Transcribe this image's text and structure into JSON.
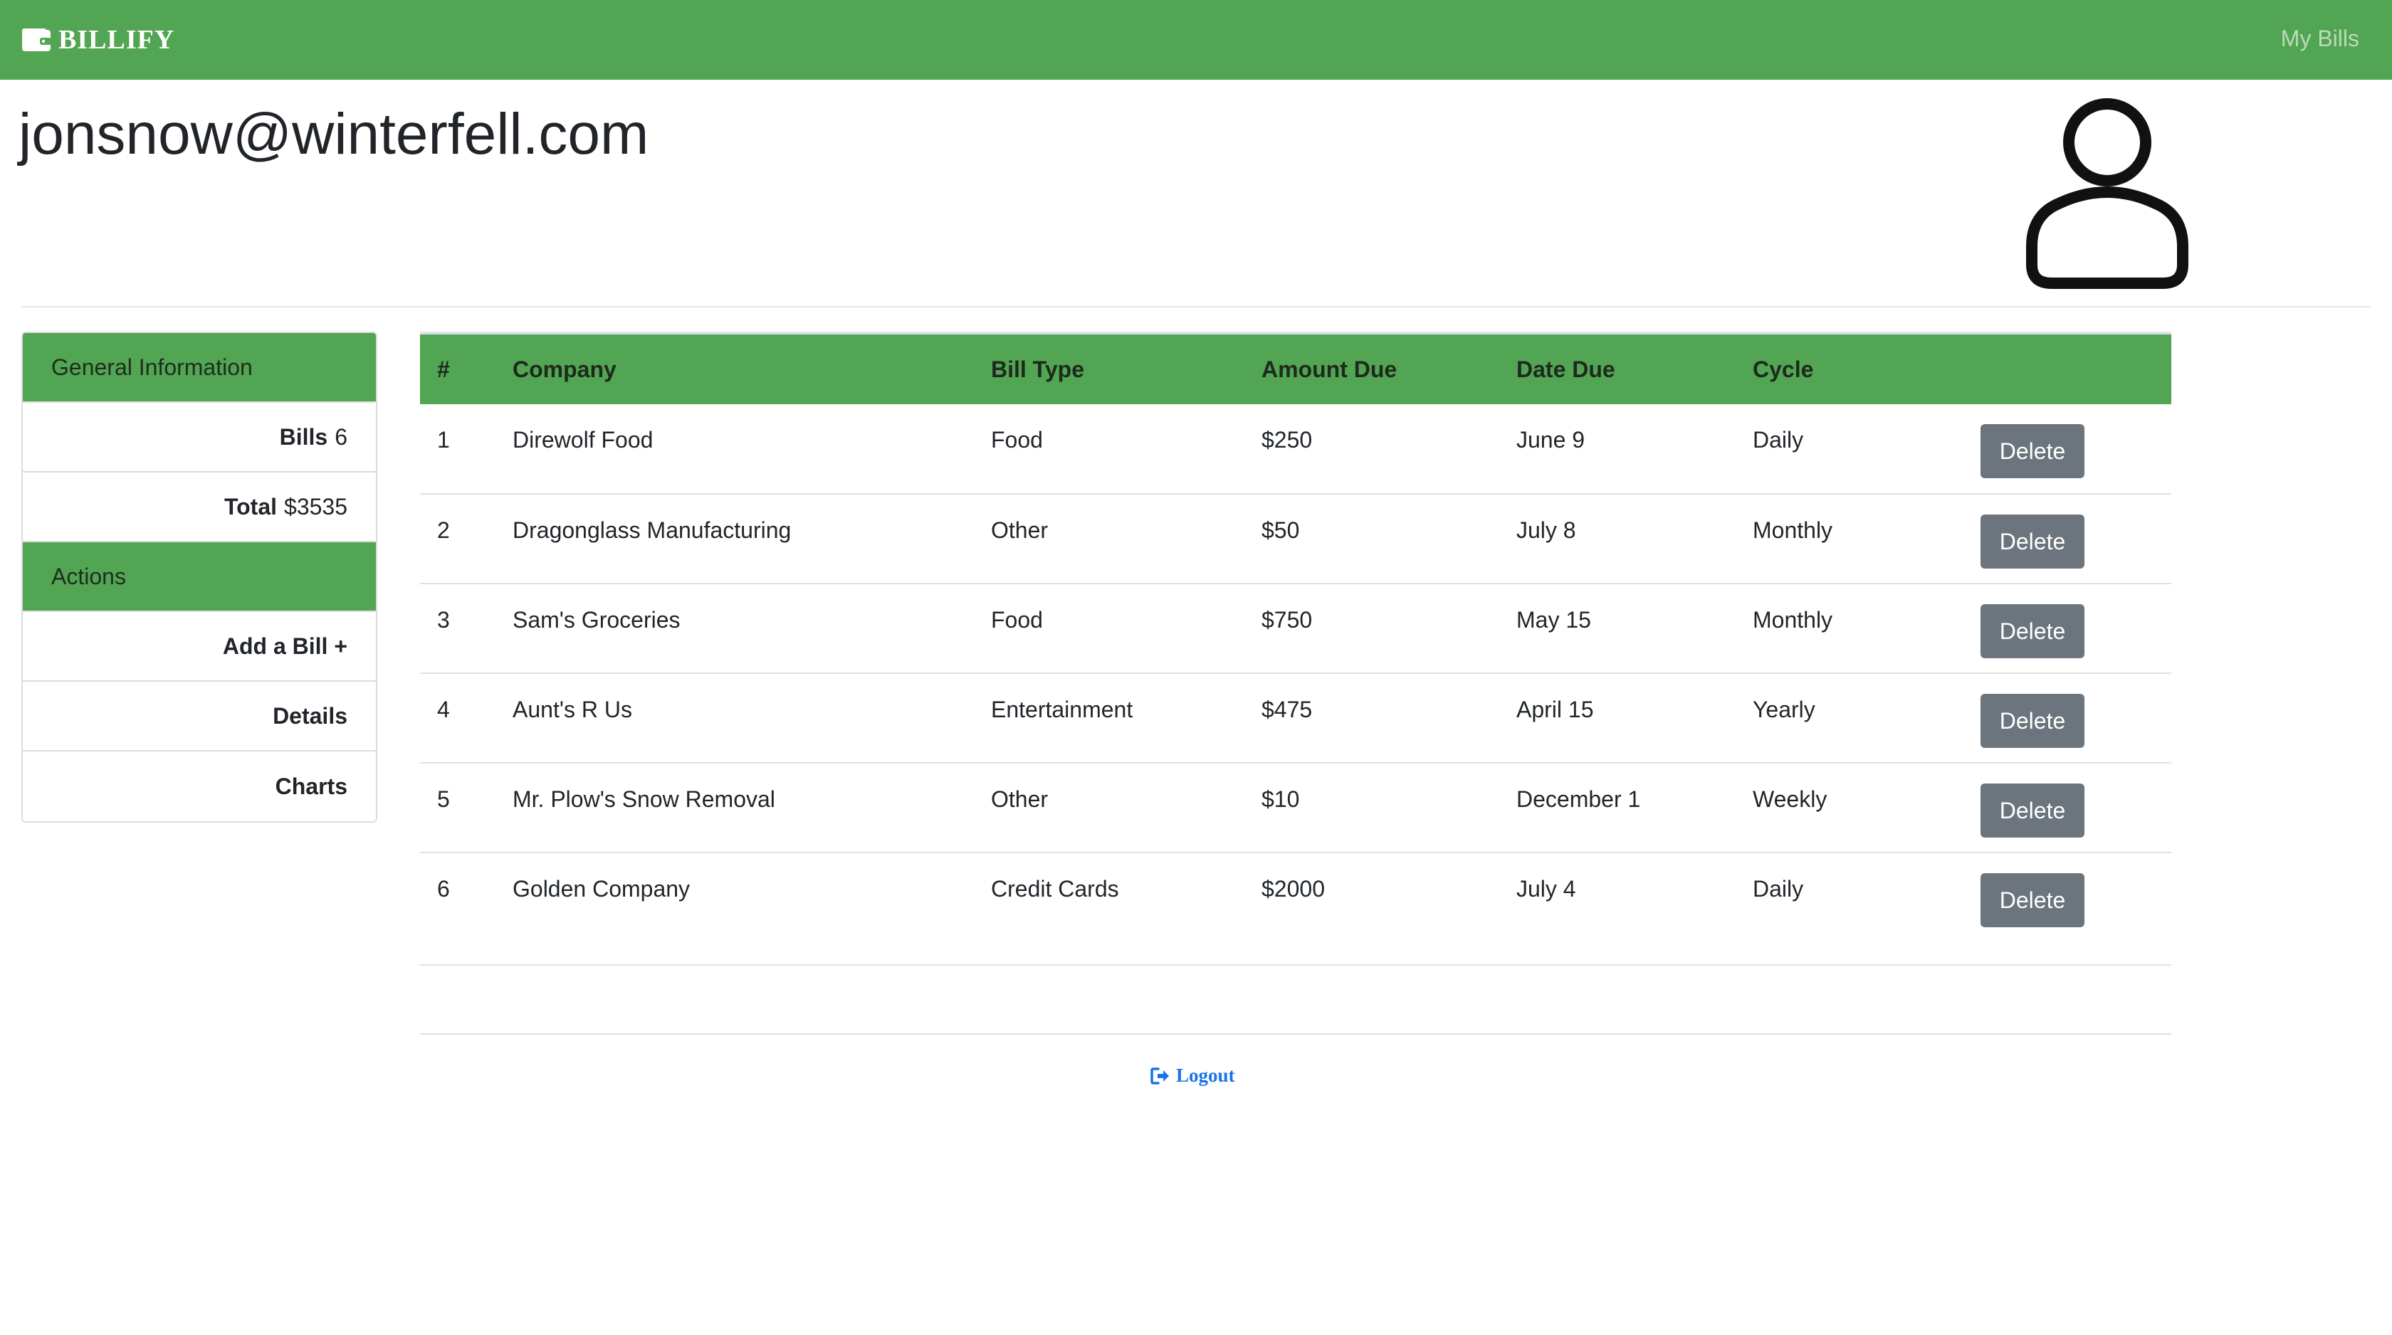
{
  "navbar": {
    "brand": "BILLIFY",
    "brand_icon": "wallet-icon",
    "link": "My Bills",
    "color": "#52a552"
  },
  "header": {
    "email": "jonsnow@winterfell.com",
    "avatar_icon": "user-icon"
  },
  "sidebar": {
    "general_heading": "General Information",
    "bills_label": "Bills",
    "bills_value": "6",
    "total_label": "Total",
    "total_value": "$3535",
    "actions_heading": "Actions",
    "add_bill": "Add a Bill +",
    "details": "Details",
    "charts": "Charts"
  },
  "table": {
    "headers": [
      "#",
      "Company",
      "Bill Type",
      "Amount Due",
      "Date Due",
      "Cycle"
    ],
    "delete_label": "Delete",
    "rows": [
      {
        "num": "1",
        "company": "Direwolf Food",
        "type": "Food",
        "amount": "$250",
        "date": "June 9",
        "cycle": "Daily"
      },
      {
        "num": "2",
        "company": "Dragonglass Manufacturing",
        "type": "Other",
        "amount": "$50",
        "date": "July 8",
        "cycle": "Monthly"
      },
      {
        "num": "3",
        "company": "Sam's Groceries",
        "type": "Food",
        "amount": "$750",
        "date": "May 15",
        "cycle": "Monthly"
      },
      {
        "num": "4",
        "company": "Aunt's R Us",
        "type": "Entertainment",
        "amount": "$475",
        "date": "April 15",
        "cycle": "Yearly"
      },
      {
        "num": "5",
        "company": "Mr. Plow's Snow Removal",
        "type": "Other",
        "amount": "$10",
        "date": "December 1",
        "cycle": "Weekly"
      },
      {
        "num": "6",
        "company": "Golden Company",
        "type": "Credit Cards",
        "amount": "$2000",
        "date": "July 4",
        "cycle": "Daily"
      }
    ]
  },
  "footer": {
    "logout": "Logout",
    "logout_icon": "logout-icon"
  }
}
